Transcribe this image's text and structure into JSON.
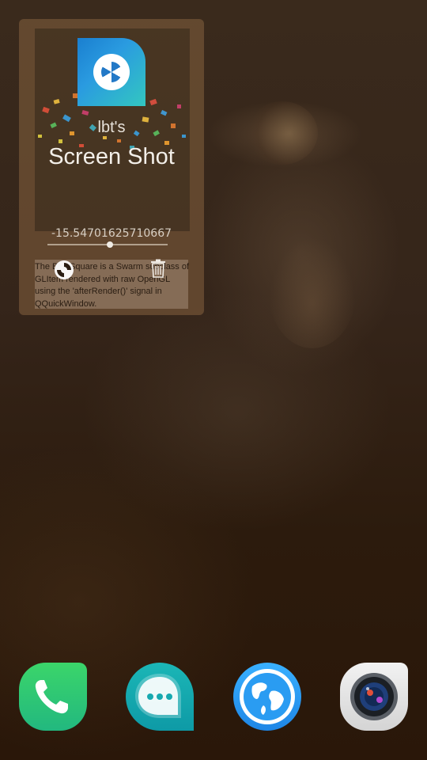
{
  "widget": {
    "app_title_line1": "lbt's",
    "app_title_line2": "Screen Shot",
    "value_readout": "-15.54701625710667",
    "slider_value_fraction": 0.52,
    "description": "The BlueSquare is a Swarm subclass of GLItem rendered with raw OpenGL using the 'afterRender()' signal in QQuickWindow."
  },
  "dock": [
    {
      "name": "phone",
      "icon": "phone-icon",
      "color": "#2ac86f"
    },
    {
      "name": "messages",
      "icon": "chat-bubble-icon",
      "color": "#17a9b0"
    },
    {
      "name": "browser",
      "icon": "globe-icon",
      "color": "#2a9cf2"
    },
    {
      "name": "camera",
      "icon": "camera-lens-icon",
      "color": "#e6e6e6"
    }
  ]
}
